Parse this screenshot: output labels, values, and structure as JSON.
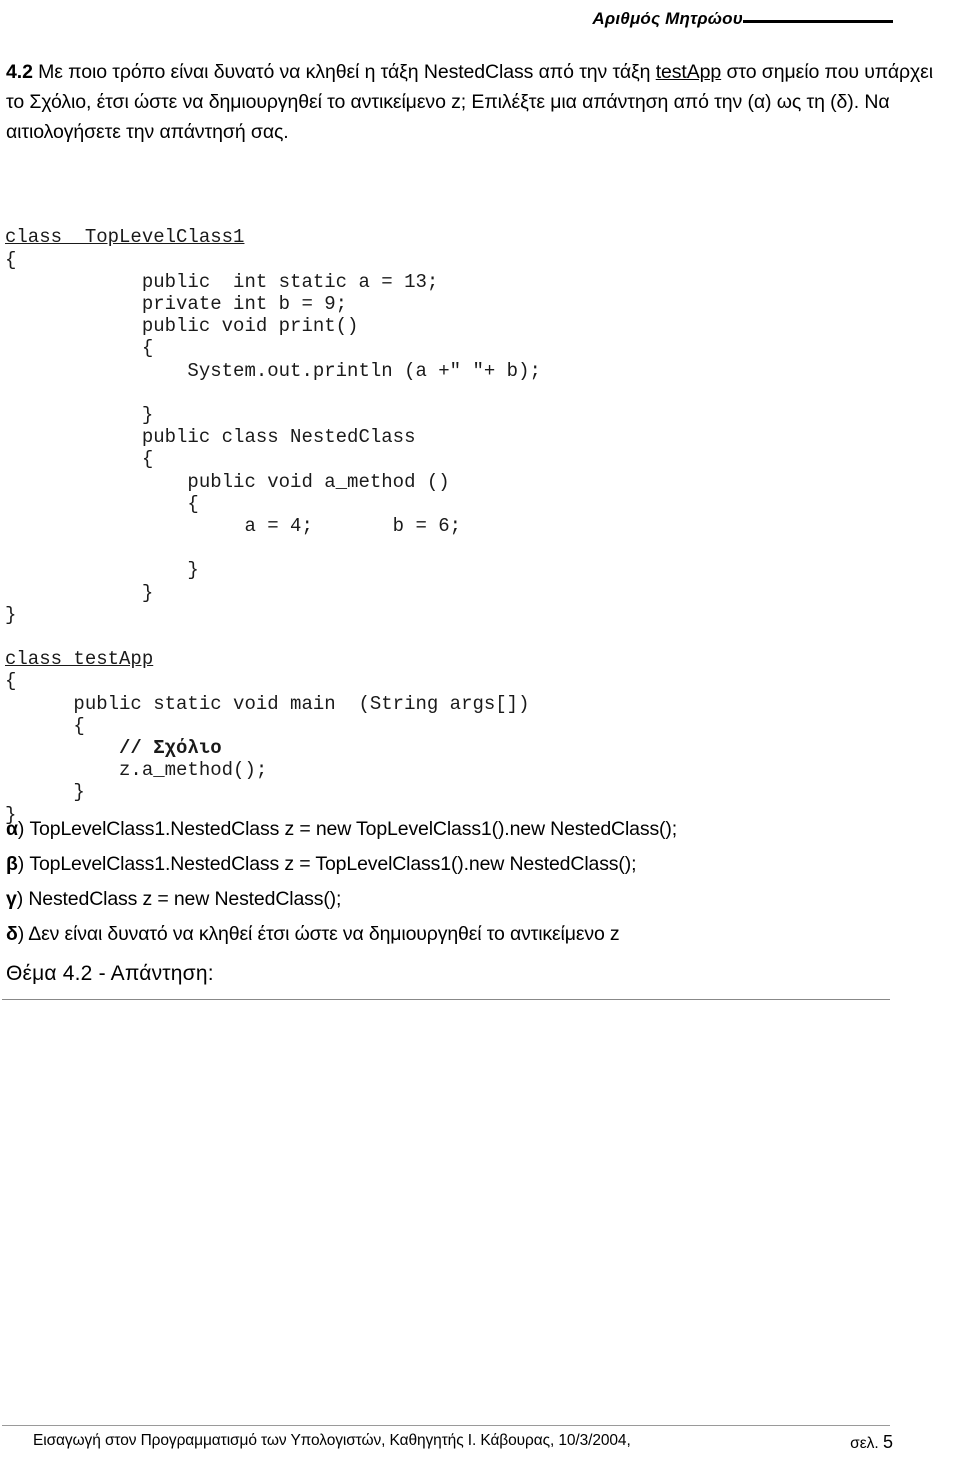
{
  "header": {
    "label": "Αριθμός Μητρώου",
    "blank_line": ""
  },
  "question": {
    "number": "4.2",
    "text_part1": " Με ποιο τρόπο είναι δυνατό να κληθεί η τάξη NestedClass από την τάξη ",
    "underlined_term": "testApp",
    "text_part2": " στο σημείο που υπάρχει το Σχόλιο, έτσι ώστε να δημιουργηθεί το αντικείμενο z; Επιλέξτε μια απάντηση από την (α) ως τη (δ). Να αιτιολογήσετε την απάντησή σας."
  },
  "code": {
    "class1_header": "class  TopLevelClass1",
    "lines": [
      "{",
      "            public  int static a = 13;",
      "            private int b = 9;",
      "            public void print()",
      "            {",
      "                System.out.println (a +\" \"+ b);",
      "",
      "            }",
      "            public class NestedClass",
      "            {",
      "                public void a_method ()",
      "                {",
      "                     a = 4;       b = 6;",
      "",
      "                }",
      "            }",
      "}"
    ],
    "class2_header": "class testApp",
    "lines2_pre": [
      "{",
      "      public static void main  (String args[])",
      "      {"
    ],
    "comment_line": "          // Σχόλιο",
    "lines2_post": [
      "          z.a_method();",
      "      }",
      "}"
    ]
  },
  "options": [
    {
      "key": "α",
      "paren": ")",
      "text": " TopLevelClass1.NestedClass z =  new TopLevelClass1().new NestedClass();"
    },
    {
      "key": "β",
      "paren": ")",
      "text": " TopLevelClass1.NestedClass z =  TopLevelClass1().new NestedClass();"
    },
    {
      "key": "γ",
      "paren": ")",
      "text": " NestedClass z =  new NestedClass();"
    },
    {
      "key": "δ",
      "paren": ")",
      "text": " Δεν είναι δυνατό να κληθεί έτσι ώστε να δημιουργηθεί το αντικείμενο z"
    }
  ],
  "answer_section": {
    "heading": "Θέμα 4.2 - Απάντηση:"
  },
  "footer": {
    "left_text": "Εισαγωγή στον Προγραμματισμό των Υπολογιστών, Καθηγητής Ι. Κάβουρας, 10/3/2004,",
    "page_label": "σελ.",
    "page_number": "5"
  },
  "colors": {
    "text": "#000000",
    "code_text": "#1a1a1a",
    "rule_gray": "#888888",
    "footer_rule": "#9a9a9a"
  }
}
